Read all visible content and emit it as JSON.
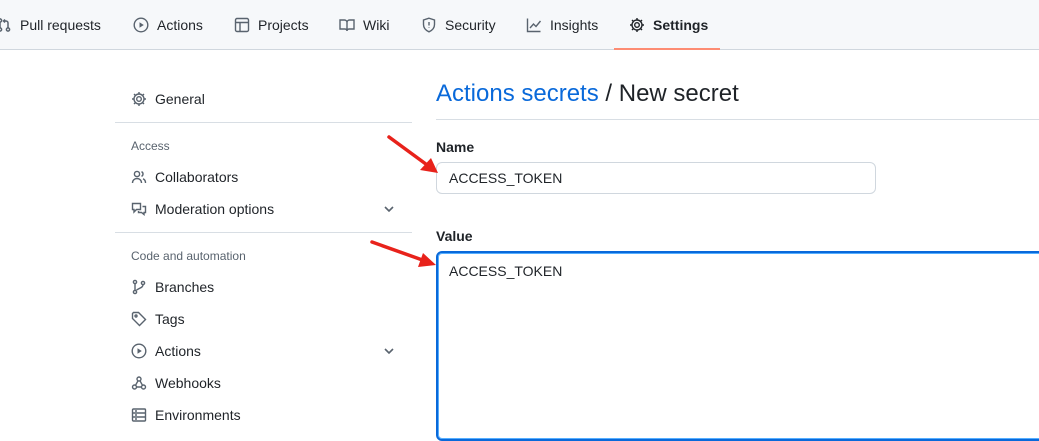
{
  "repo_nav": {
    "tabs": [
      {
        "label": "Pull requests",
        "icon": "pull-request-icon"
      },
      {
        "label": "Actions",
        "icon": "play-icon"
      },
      {
        "label": "Projects",
        "icon": "table-icon"
      },
      {
        "label": "Wiki",
        "icon": "book-icon"
      },
      {
        "label": "Security",
        "icon": "shield-icon"
      },
      {
        "label": "Insights",
        "icon": "graph-icon"
      },
      {
        "label": "Settings",
        "icon": "gear-icon",
        "active": true
      }
    ]
  },
  "sidebar": {
    "general": {
      "label": "General",
      "icon": "gear-icon"
    },
    "access_heading": "Access",
    "access_items": [
      {
        "label": "Collaborators",
        "icon": "people-icon"
      },
      {
        "label": "Moderation options",
        "icon": "comment-discussion-icon",
        "expandable": true
      }
    ],
    "automation_heading": "Code and automation",
    "automation_items": [
      {
        "label": "Branches",
        "icon": "git-branch-icon"
      },
      {
        "label": "Tags",
        "icon": "tag-icon"
      },
      {
        "label": "Actions",
        "icon": "play-icon",
        "expandable": true
      },
      {
        "label": "Webhooks",
        "icon": "webhook-icon"
      },
      {
        "label": "Environments",
        "icon": "server-icon"
      }
    ]
  },
  "main": {
    "breadcrumb_link": "Actions secrets",
    "breadcrumb_separator": " / ",
    "page_title": "New secret",
    "name_label": "Name",
    "name_value": "ACCESS_TOKEN",
    "value_label": "Value",
    "value_value": "ACCESS_TOKEN"
  },
  "colors": {
    "accent": "#0969da",
    "active_tab_underline": "#fd8c73",
    "annotation_arrow": "#e8221b"
  }
}
